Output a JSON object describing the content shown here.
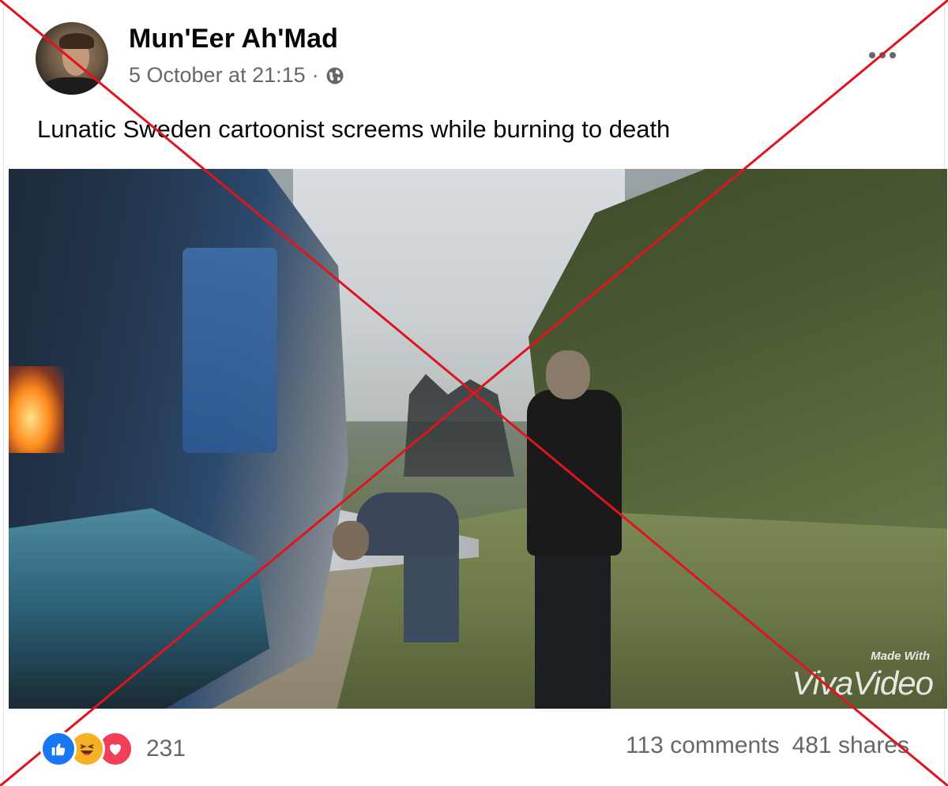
{
  "post": {
    "author": "Mun'Eer Ah'Mad",
    "timestamp": "5 October at 21:15",
    "separator": "·",
    "privacy_icon": "globe-icon",
    "menu_icon": "more-options-icon",
    "caption": "Lunatic Sweden cartoonist screems while burning to death"
  },
  "media": {
    "watermark_small": "Made With",
    "watermark_big": "VivaVideo"
  },
  "footer": {
    "reaction_icons": [
      "like-icon",
      "haha-icon",
      "love-icon"
    ],
    "reaction_count": "231",
    "comments": "113 comments",
    "shares": "481 shares"
  },
  "overlay": {
    "cross_color": "#e0141e"
  },
  "colors": {
    "secondary_text": "#65676b",
    "like": "#1877f2",
    "haha": "#f7b125",
    "love": "#f33e58"
  }
}
